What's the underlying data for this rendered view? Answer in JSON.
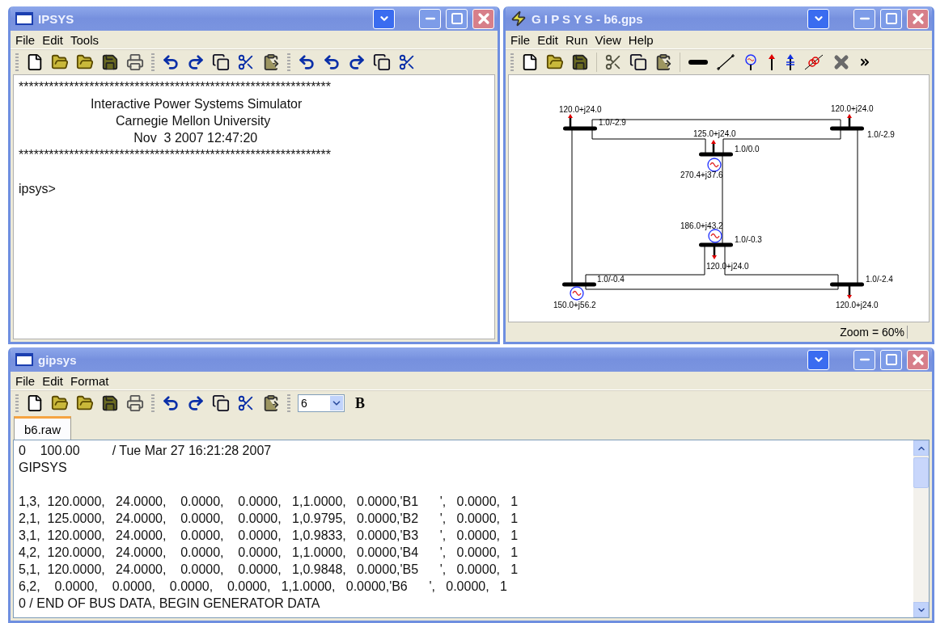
{
  "console_window": {
    "title": "IPSYS",
    "menu": [
      "File",
      "Edit",
      "Tools"
    ],
    "banner_lines": [
      "**************************************************************",
      "                    Interactive Power Systems Simulator",
      "                           Carnegie Mellon University",
      "                                Nov  3 2007 12:47:20",
      "**************************************************************"
    ],
    "prompt": "ipsys>"
  },
  "diagram_window": {
    "title": "G I P S Y S - b6.gps",
    "menu": [
      "File",
      "Edit",
      "Run",
      "View",
      "Help"
    ],
    "diagram": {
      "bus_voltages": [
        "1.0/-2.9",
        "1.0/-2.9",
        "1.0/0.0",
        "1.0/-0.3",
        "1.0/-0.4",
        "1.0/-2.4"
      ],
      "loads": [
        "120.0+j24.0",
        "120.0+j24.0",
        "125.0+j24.0",
        "120.0+j24.0",
        "120.0+j24.0"
      ],
      "generators": [
        "270.4+j37.6",
        "186.0+j43.2",
        "150.0+j56.2"
      ]
    },
    "status_bar": "Zoom = 60%"
  },
  "editor_window": {
    "title": "gipsys",
    "menu": [
      "File",
      "Edit",
      "Format"
    ],
    "font_size": "6",
    "bold_button": "B",
    "tabs": [
      {
        "label": "b6.raw",
        "selected": true
      }
    ],
    "header_lines": [
      "0    100.00         / Tue Mar 27 16:21:28 2007",
      "GIPSYS"
    ],
    "bus_lines": [
      "1,3,  120.0000,   24.0000,    0.0000,    0.0000,   1,1.0000,   0.0000,'B1      ',   0.0000,   1",
      "2,1,  125.0000,   24.0000,    0.0000,    0.0000,   1,0.9795,   0.0000,'B2      ',   0.0000,   1",
      "3,1,  120.0000,   24.0000,    0.0000,    0.0000,   1,0.9833,   0.0000,'B3      ',   0.0000,   1",
      "4,2,  120.0000,   24.0000,    0.0000,    0.0000,   1,1.0000,   0.0000,'B4      ',   0.0000,   1",
      "5,1,  120.0000,   24.0000,    0.0000,    0.0000,   1,0.9848,   0.0000,'B5      ',   0.0000,   1",
      "6,2,    0.0000,    0.0000,    0.0000,    0.0000,   1,1.0000,   0.0000,'B6      ',   0.0000,   1",
      "0 / END OF BUS DATA, BEGIN GENERATOR DATA"
    ]
  }
}
